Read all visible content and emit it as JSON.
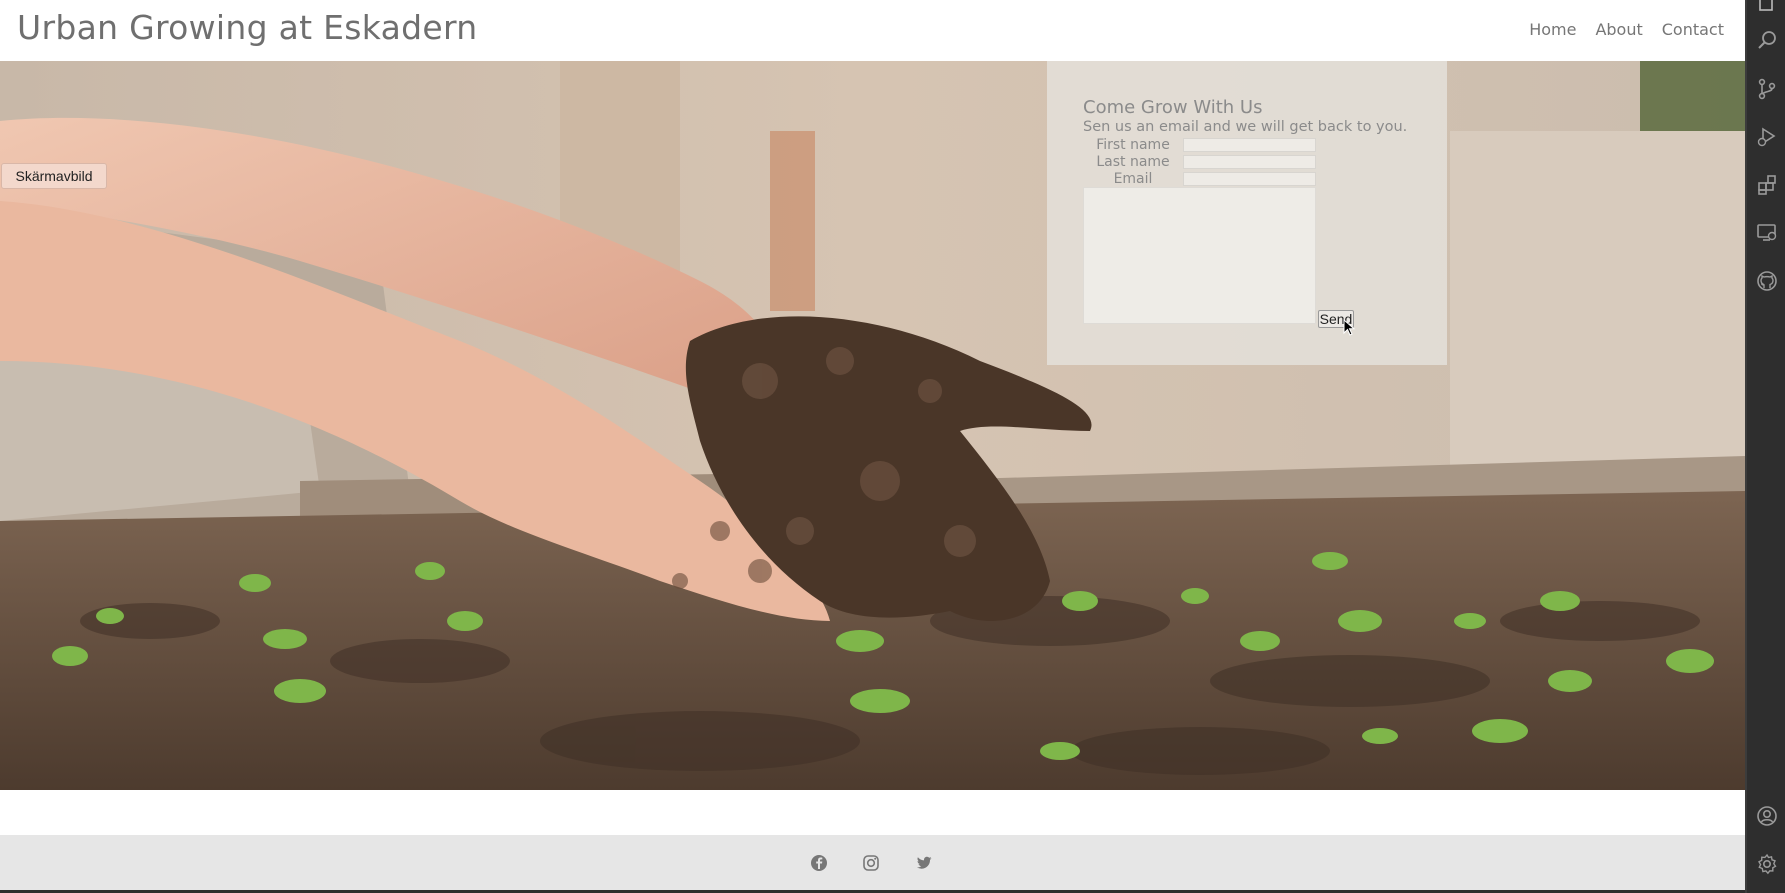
{
  "header": {
    "site_title": "Urban Growing at Eskadern",
    "nav": [
      {
        "label": "Home"
      },
      {
        "label": "About"
      },
      {
        "label": "Contact"
      }
    ]
  },
  "screenshot_tag": {
    "label": "Skärmavbild"
  },
  "contact_form": {
    "title": "Come Grow With Us",
    "subtitle": "Sen us an email and we will get back to you.",
    "fields": [
      {
        "label": "First name",
        "value": ""
      },
      {
        "label": "Last name",
        "value": ""
      },
      {
        "label": "Email",
        "value": ""
      }
    ],
    "message_value": "",
    "send_label": "Send"
  },
  "footer": {
    "social_icons": [
      "facebook-icon",
      "instagram-icon",
      "twitter-icon"
    ]
  },
  "activity_bar": {
    "icons": [
      "explorer-icon",
      "search-icon",
      "source-control-icon",
      "run-debug-icon",
      "extensions-icon",
      "remote-explorer-icon",
      "github-icon",
      "account-icon",
      "settings-gear-icon"
    ]
  },
  "colors": {
    "title_text": "#6f6f6f",
    "nav_text": "#767676",
    "footer_bg": "#e6e6e6",
    "activity_bar_bg": "#2e2e2e"
  }
}
